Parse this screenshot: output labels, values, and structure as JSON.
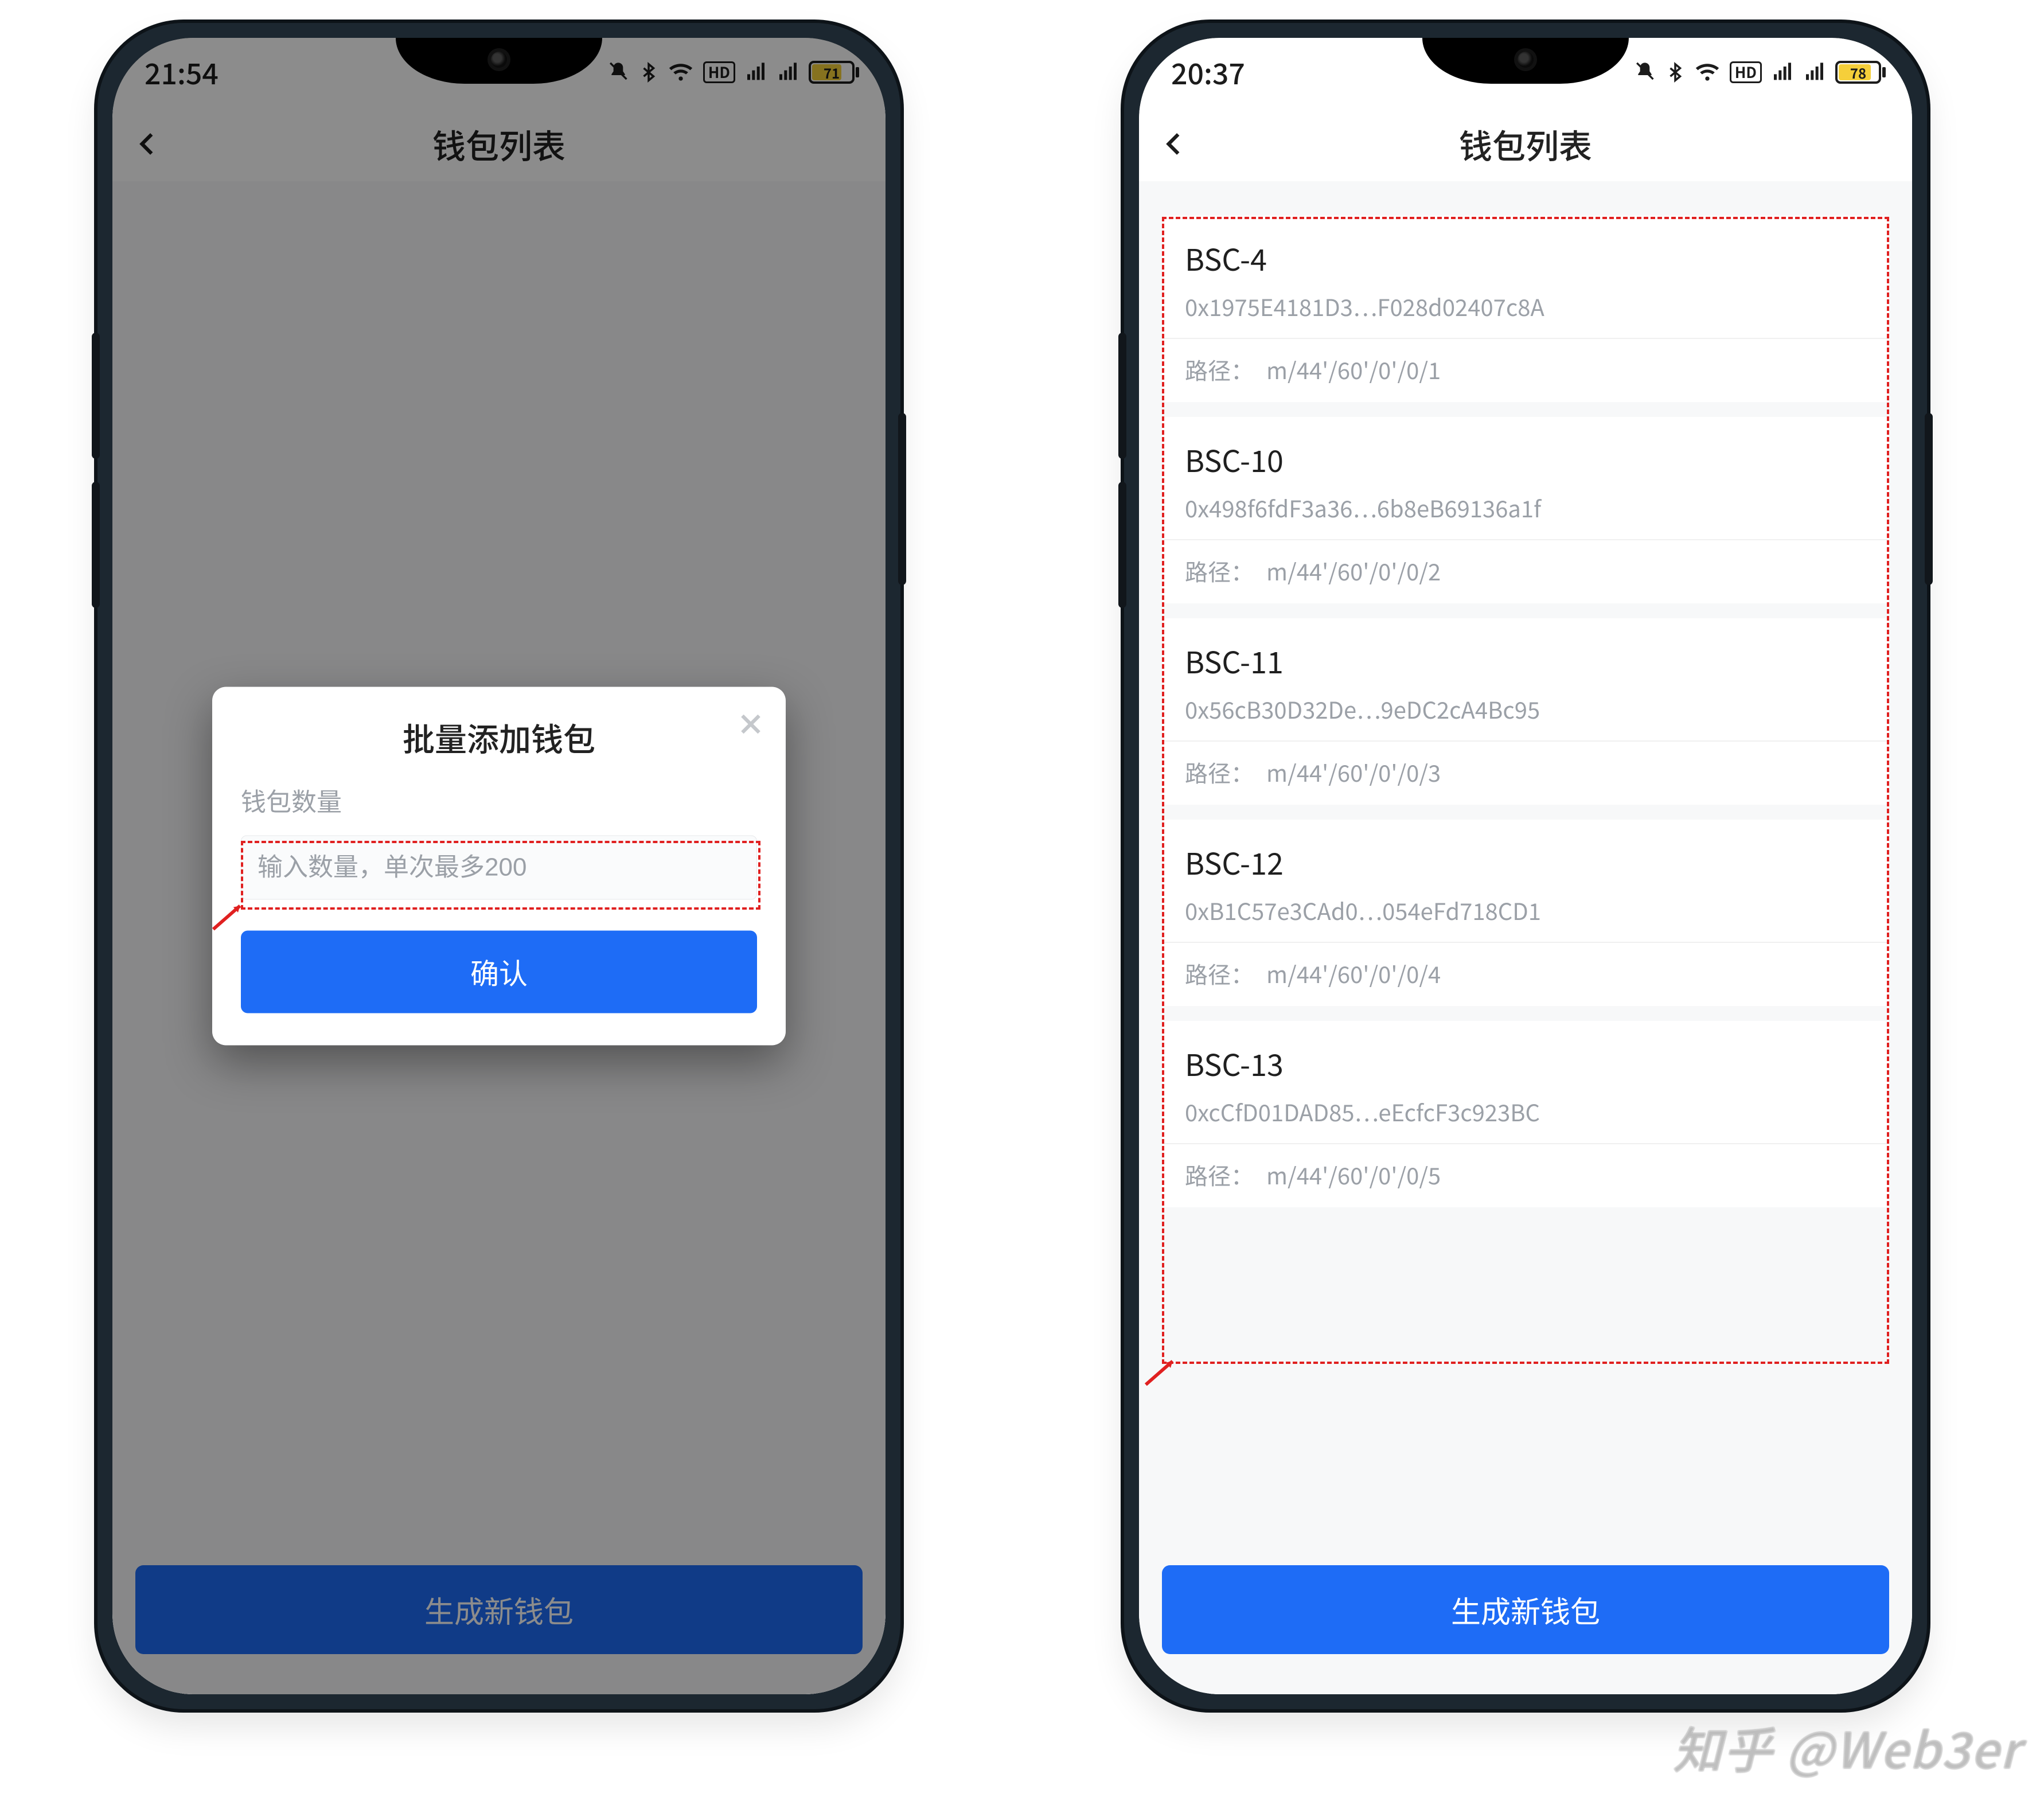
{
  "watermark": "知乎 @Web3er",
  "phones": {
    "left": {
      "status": {
        "time": "21:54",
        "battery": "71",
        "hd": "HD"
      },
      "header": {
        "title": "钱包列表"
      },
      "bottom_button": "生成新钱包",
      "modal": {
        "title": "批量添加钱包",
        "label": "钱包数量",
        "placeholder": "输入数量，单次最多200",
        "confirm": "确认"
      }
    },
    "right": {
      "status": {
        "time": "20:37",
        "battery": "78",
        "hd": "HD"
      },
      "header": {
        "title": "钱包列表"
      },
      "bottom_button": "生成新钱包",
      "wallets": [
        {
          "name": "BSC-4",
          "addr": "0x1975E4181D3…F028d02407c8A",
          "path_label": "路径：",
          "path": "m/44'/60'/0'/0/1"
        },
        {
          "name": "BSC-10",
          "addr": "0x498f6fdF3a36…6b8eB69136a1f",
          "path_label": "路径：",
          "path": "m/44'/60'/0'/0/2"
        },
        {
          "name": "BSC-11",
          "addr": "0x56cB30D32De…9eDC2cA4Bc95",
          "path_label": "路径：",
          "path": "m/44'/60'/0'/0/3"
        },
        {
          "name": "BSC-12",
          "addr": "0xB1C57e3CAd0…054eFd718CD1",
          "path_label": "路径：",
          "path": "m/44'/60'/0'/0/4"
        },
        {
          "name": "BSC-13",
          "addr": "0xcCfD01DAD85…eEcfcF3c923BC",
          "path_label": "路径：",
          "path": "m/44'/60'/0'/0/5"
        }
      ]
    }
  }
}
